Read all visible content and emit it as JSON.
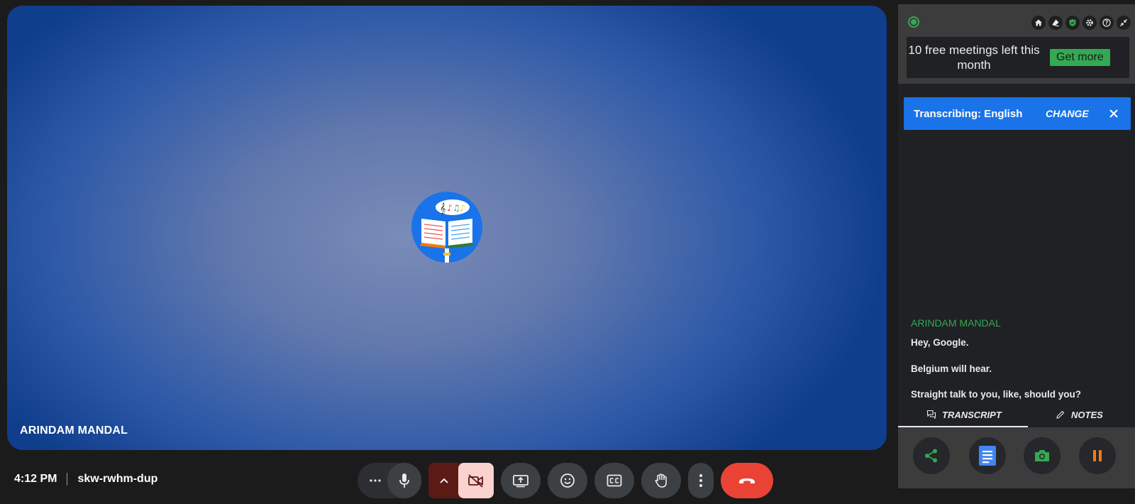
{
  "stage": {
    "participant_name": "ARINDAM MANDAL",
    "avatar": "music-book-icon"
  },
  "meeting": {
    "time": "4:12 PM",
    "code": "skw-rwhm-dup"
  },
  "controls": [
    {
      "name": "more-options-icon"
    },
    {
      "name": "microphone-icon"
    },
    {
      "name": "chevron-up-icon"
    },
    {
      "name": "camera-off-icon"
    },
    {
      "name": "present-screen-icon"
    },
    {
      "name": "emoji-icon"
    },
    {
      "name": "captions-icon"
    },
    {
      "name": "raise-hand-icon"
    },
    {
      "name": "more-vert-icon"
    },
    {
      "name": "end-call-icon"
    }
  ],
  "panel": {
    "top_icons": [
      "home-icon",
      "eraser-icon",
      "shield-icon",
      "gear-icon",
      "help-icon",
      "collapse-icon"
    ],
    "promo": {
      "text": "10 free meetings left this month",
      "button": "Get more"
    },
    "banner": {
      "text": "Transcribing: English",
      "change": "CHANGE"
    },
    "transcript": {
      "speaker": "ARINDAM MANDAL",
      "lines": [
        "Hey, Google.",
        "Belgium will hear.",
        "Straight talk to you, like, should you?"
      ]
    },
    "tabs": {
      "transcript": "TRANSCRIPT",
      "notes": "NOTES"
    },
    "dock": [
      "share-icon",
      "docs-icon",
      "camera-icon",
      "pause-icon"
    ]
  },
  "colors": {
    "end_call": "#ea4335",
    "camera_off_bg": "#fad2cf",
    "camera_off_split": "#5c1a14",
    "accent_green": "#34a853",
    "accent_blue": "#1a73e8",
    "pause_orange": "#fa7b17"
  }
}
